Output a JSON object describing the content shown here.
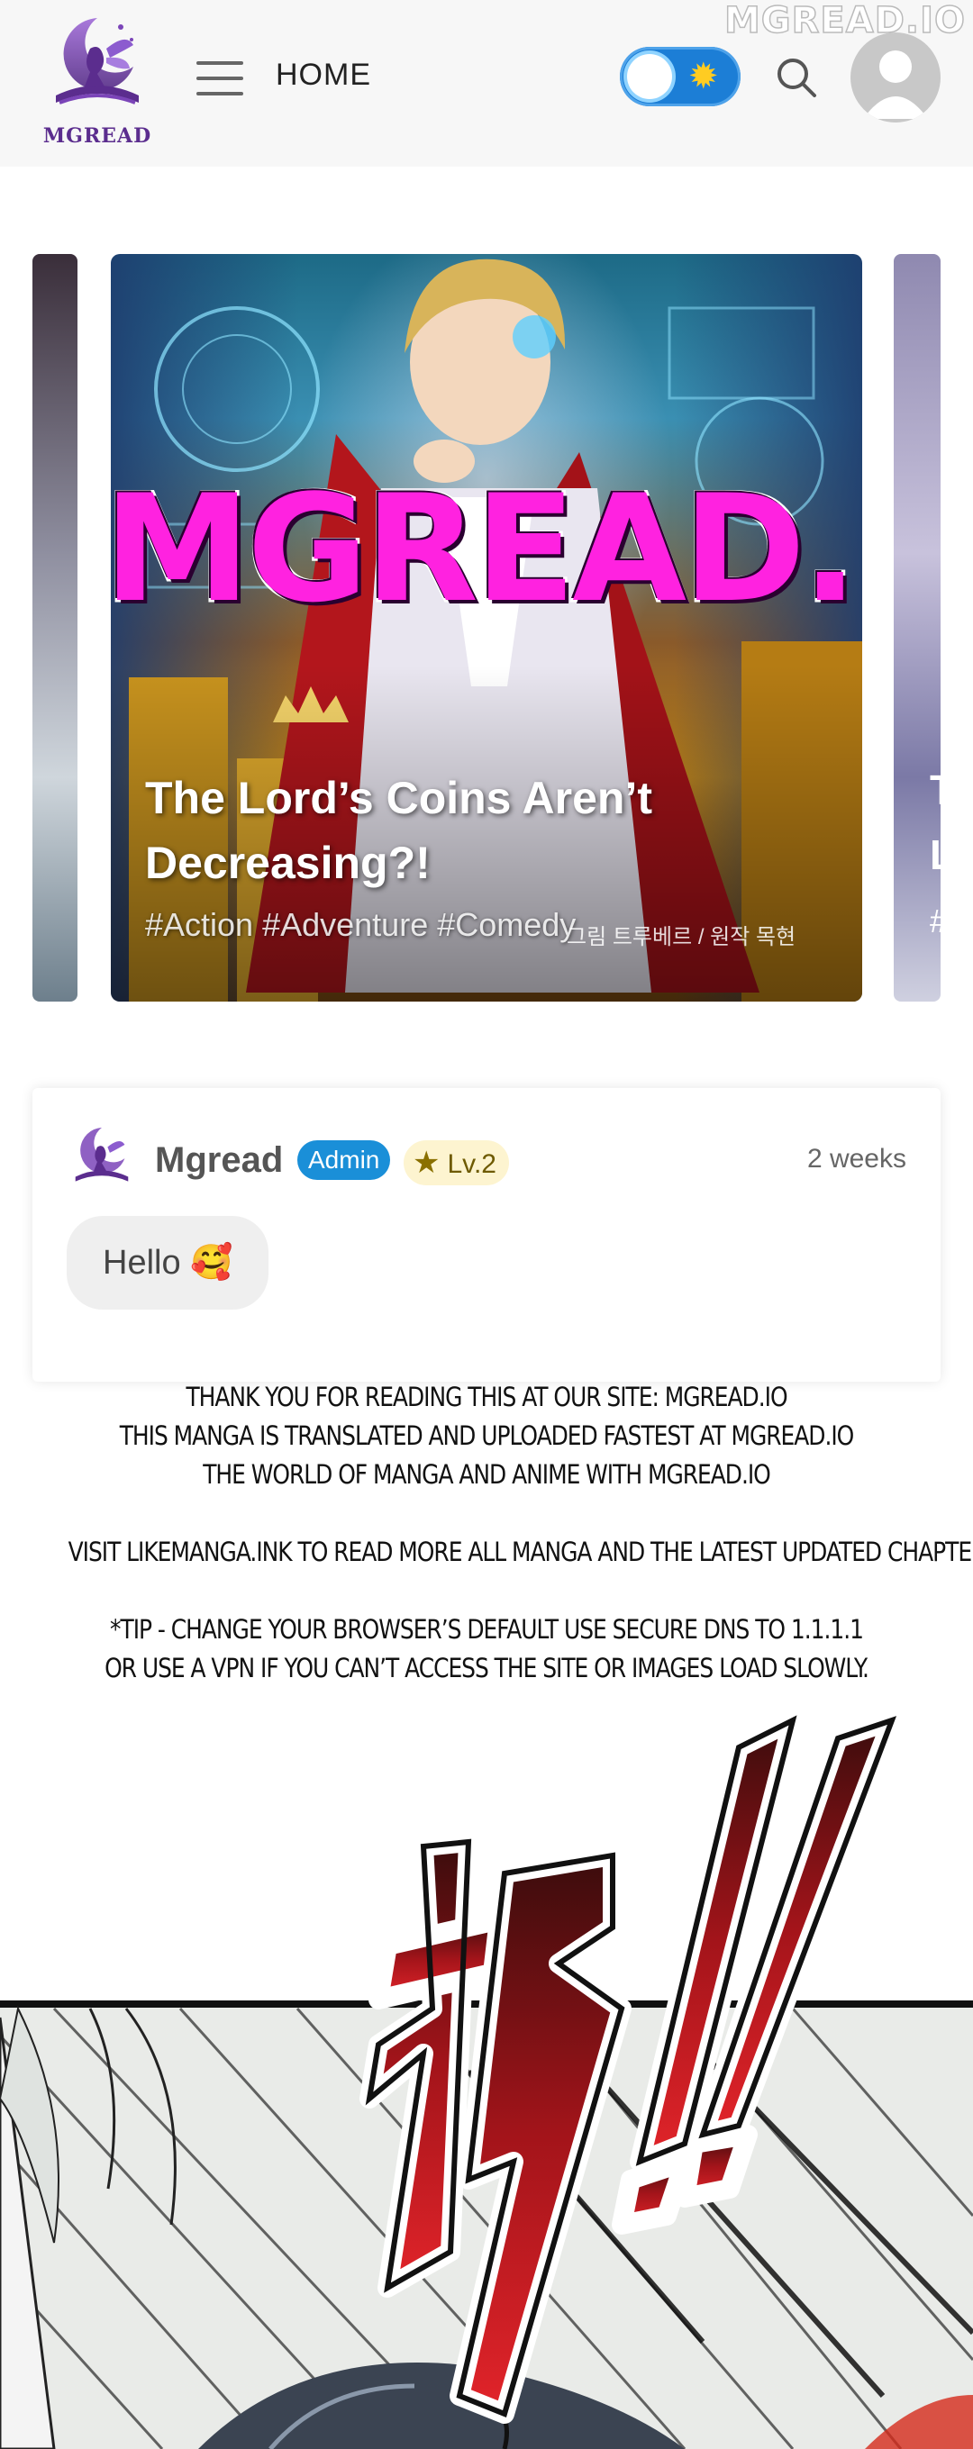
{
  "site": {
    "logo_text": "MGREAD",
    "watermark": "MGREAD.IO"
  },
  "header": {
    "menu_icon": "hamburger-menu-icon",
    "home_label": "HOME",
    "theme_toggle": {
      "state": "light",
      "icon": "sun-icon"
    },
    "search_icon": "search-icon",
    "avatar_icon": "user-avatar-icon"
  },
  "carousel": {
    "featured": {
      "title": "The Lord’s Coins Aren’t Decreasing?!",
      "tags": "#Action #Adventure #Comedy",
      "overlay_watermark": "MGREAD.IO",
      "korean_credit": "그림 트루베르 / 원작 목현"
    },
    "next_fragment_letters": [
      "T",
      "L",
      "#"
    ]
  },
  "comment": {
    "username": "Mgread",
    "role_badge": "Admin",
    "level_badge": "Lv.2",
    "time": "2 weeks",
    "message": "Hello 🥰"
  },
  "notice": {
    "lines": [
      "Thank you for reading this at our site: mgread.io",
      "This manga is translated and uploaded fastest at mgread.io",
      "The world of manga and anime with mgread.io",
      "",
      "Visit likemanga.ink to read more all manga and the latest updated chapters.",
      "",
      "*Tip - Change your browser’s default use secure DNS to 1.1.1.1",
      "or use a VPN if you can’t access the site or images load slowly."
    ]
  },
  "panel": {
    "sfx_text": "砰!!"
  },
  "colors": {
    "brand_purple": "#5b2d8e",
    "admin_blue": "#1a8fd8",
    "watermark_magenta": "#ff22e0",
    "toggle_blue": "#1c7ed6"
  }
}
